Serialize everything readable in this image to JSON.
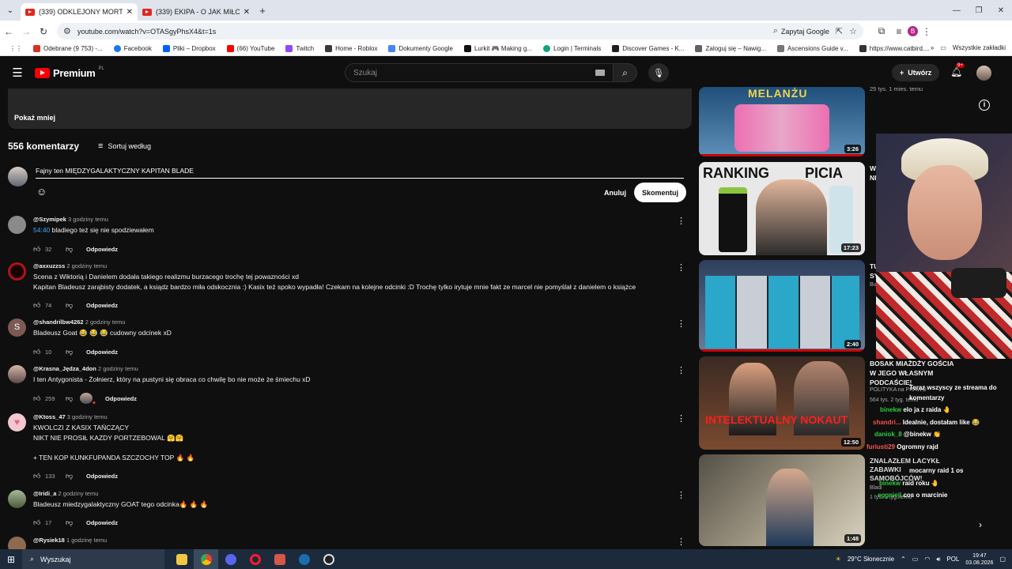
{
  "browser": {
    "tabs": [
      {
        "title": "(339) ODKLEJONY MORTALCIO",
        "active": true
      },
      {
        "title": "(339) EKIPA - O JAK MIŁO (Wuj",
        "active": false
      }
    ],
    "url": "youtube.com/watch?v=OTASgyPhsX4&t=1s",
    "ask_google": "Zapytaj Google",
    "profile_letter": "B",
    "bookmarks": [
      {
        "label": "Odebrane (9 753) -...",
        "color": "#d93025"
      },
      {
        "label": "Facebook",
        "color": "#1877f2"
      },
      {
        "label": "Pliki – Dropbox",
        "color": "#0061fe"
      },
      {
        "label": "(66) YouTube",
        "color": "#ff0000"
      },
      {
        "label": "Twitch",
        "color": "#9146ff"
      },
      {
        "label": "Home - Roblox",
        "color": "#3a3a3a"
      },
      {
        "label": "Dokumenty Google",
        "color": "#4285f4"
      },
      {
        "label": "Lurkit 🎮 Making g...",
        "color": "#111111"
      },
      {
        "label": "Login | Terminals",
        "color": "#10a37f"
      },
      {
        "label": "Discover Games - K...",
        "color": "#202020"
      },
      {
        "label": "Zaloguj się – Nawig...",
        "color": "#5f6368"
      },
      {
        "label": "Ascensions Guide v...",
        "color": "#777777"
      },
      {
        "label": "https://www.catbird....",
        "color": "#333333"
      }
    ],
    "bookmarks_more": "»",
    "all_bookmarks": "Wszystkie zakładki"
  },
  "youtube": {
    "logo": "Premium",
    "region": "PL",
    "search_placeholder": "Szukaj",
    "create_label": "Utwórz",
    "notif_count": "9+"
  },
  "comments_section": {
    "show_less": "Pokaż mniej",
    "count": "556 komentarzy",
    "sort_label": "Sortuj według",
    "input_value": "Fajny ten MIĘDZYGALAKTYCZNY KAPITAN BLADE",
    "cancel_label": "Anuluj",
    "submit_label": "Skomentuj",
    "reply_label": "Odpowiedz",
    "comments": [
      {
        "author": "@Szymipek",
        "time": "3 godziny temu",
        "timestamp": "54:40",
        "text": "bladiego też się nie spodziewałem",
        "likes": "32",
        "avatar": "#8a8a8a"
      },
      {
        "author": "@axxuzzss",
        "time": "2 godziny temu",
        "text": "Scena z Wiktorią i Danielem dodała takiego realizmu burzacego trochę tej powazności xd\nKapitan Bladeusz zarąbisty dodatek, a ksiądz bardzo miła odskocznia :) Kasix też spoko wypadła! Czekam na kolejne odcinki :D Trochę tylko irytuje mnie fakt ze marcel nie pomyślał z danielem o książce",
        "likes": "74",
        "avatar": "#b3121d"
      },
      {
        "author": "@shandrilbw4262",
        "time": "2 godziny temu",
        "text": "Bladeusz Goat 😂 😂 😂 cudowny odcinek xD",
        "likes": "10",
        "avatar": "#7b5a54",
        "initial": "S"
      },
      {
        "author": "@Krasna_Jędza_4don",
        "time": "2 godziny temu",
        "text": "I ten Antygonista - Żołnierz, który na pustyni się obraca co chwilę bo nie może że śmiechu xD",
        "likes": "259",
        "avatar": "#9e8a7e",
        "hearted": true
      },
      {
        "author": "@Ktoss_47",
        "time": "3 godziny temu",
        "text": "KWOLCZI Z KASIX TAŃCZĄCY\nNIKT NIE PROSIŁ KAZDY PORTZEBOWAL 🤗🤗\n\n+ TEN KOP KUNKFUPANDA SZCZOCHY TOP 🔥 🔥",
        "likes": "133",
        "avatar": "#f4c6cf"
      },
      {
        "author": "@Iridi_a",
        "time": "2 godziny temu",
        "text": "Bladeusz miedzygalaktyczny GOAT tego odcinka🔥 🔥 🔥",
        "likes": "17",
        "avatar": "#6b7d5a"
      },
      {
        "author": "@Rysiek18",
        "time": "1 godzinę temu",
        "text": "",
        "likes": "",
        "avatar": "#8e6b4e"
      }
    ]
  },
  "sidebar": {
    "top_meta": "25 tys.  1 mies. temu",
    "videos": [
      {
        "thumb_text": "MELANŻU",
        "duration": "3:26",
        "watched": true,
        "bg": "#3a6fa0"
      },
      {
        "thumb_text": "RANKING PICIA",
        "duration": "17:23",
        "watched": false,
        "bg": "#e8e8e8"
      },
      {
        "thumb_text": "",
        "duration": "2:40",
        "watched": true,
        "bg": "#455d80"
      },
      {
        "thumb_text": "INTELEKTUALNY NOKAUT",
        "duration": "12:50",
        "watched": false,
        "bg": "#5a4030"
      },
      {
        "thumb_text": "",
        "duration": "1:48",
        "watched": false,
        "bg": "#7a7468"
      }
    ],
    "partial_titles": [
      "W",
      "NI",
      "TU",
      "SY",
      "Bu"
    ],
    "video4_title": "BOSAK MIAŻDŻY GOŚCIA W JEGO WŁASNYM PODCAŚCIE!",
    "video4_channel": "POLITYKA na PRAWO",
    "video4_meta": "564 tys.  2 tyg. temu",
    "video5_title_partial": "ZNALAZŁEM LACYKŁ ZABAWKI SAMOBÓJCÓW!",
    "video5_channel": "Bladi",
    "video5_meta": "1 tys. 1 tyg. temu"
  },
  "stream_chat": [
    {
      "user": "",
      "msg": "Teraz wszyscy ze streama do komentarzy",
      "color": "#ff4444"
    },
    {
      "user": "binekw",
      "msg": "elo ja z raida 🤚",
      "color": "#2ecc40"
    },
    {
      "user": "shandri...",
      "msg": "Idealnie, dostałam like 😂",
      "color": "#ff4d4d"
    },
    {
      "user": "daniok_8",
      "msg": "@binekw 👏",
      "color": "#2ecc40"
    },
    {
      "user": "furiusti29",
      "msg": "Ogromny rajd",
      "color": "#ff5555"
    },
    {
      "user": "",
      "msg": "mocarny raid 1 os",
      "color": "#1e90ff"
    },
    {
      "user": "binekw",
      "msg": "raid roku 🤚",
      "color": "#2ecc40"
    },
    {
      "user": "eggniejl",
      "msg": "cos o marcinie",
      "color": "#2ecc40"
    }
  ],
  "taskbar": {
    "search_placeholder": "Wyszukaj",
    "weather": "29°C  Słonecznie",
    "lang": "POL",
    "time": "19:47",
    "date": "03.08.2026"
  }
}
